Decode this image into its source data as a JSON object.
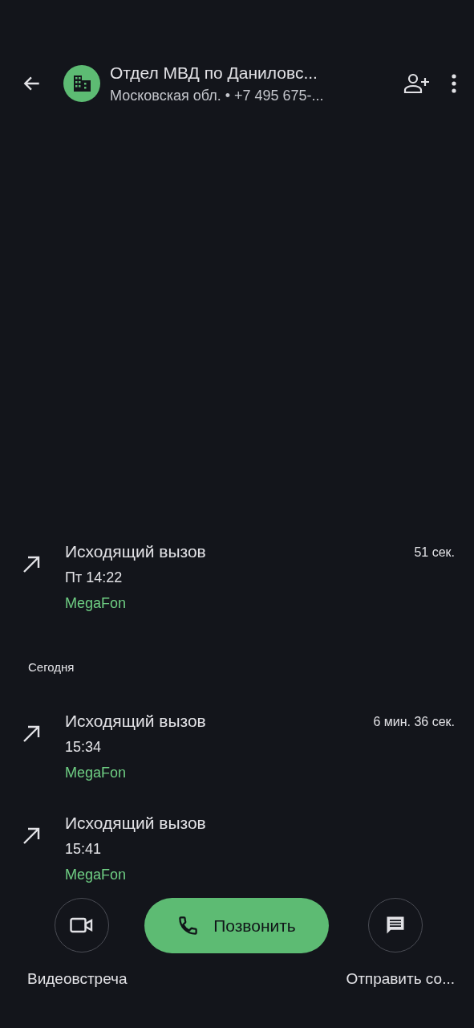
{
  "header": {
    "title": "Отдел МВД по Даниловс...",
    "subtitle": "Московская обл. • +7 495 675-..."
  },
  "call_log": [
    {
      "kind": "call",
      "title": "Исходящий вызов",
      "time": "Пт 14:22",
      "carrier": "MegaFon",
      "duration": "51 сек."
    },
    {
      "kind": "date_header",
      "label": "Сегодня"
    },
    {
      "kind": "call",
      "title": "Исходящий вызов",
      "time": "15:34",
      "carrier": "MegaFon",
      "duration": "6 мин. 36 сек."
    },
    {
      "kind": "call",
      "title": "Исходящий вызов",
      "time": "15:41",
      "carrier": "MegaFon"
    }
  ],
  "actions": {
    "video_label": "Видеовстреча",
    "call_label": "Позвонить",
    "message_label": "Отправить со..."
  }
}
